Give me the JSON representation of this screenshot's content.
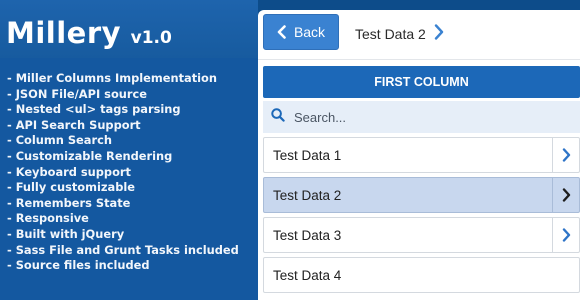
{
  "brand": {
    "name": "Millery",
    "version": "v1.0"
  },
  "features": [
    "- Miller Columns Implementation",
    "- JSON File/API source",
    "- Nested <ul> tags parsing",
    "- API Search Support",
    "- Column Search",
    "- Customizable Rendering",
    "- Keyboard support",
    "- Fully customizable",
    "- Remembers State",
    "- Responsive",
    "- Built with jQuery",
    "- Sass File and Grunt Tasks included",
    "- Source files included"
  ],
  "toolbar": {
    "back_label": "Back",
    "breadcrumb": "Test Data 2"
  },
  "column": {
    "title": "FIRST COLUMN",
    "search_placeholder": "Search...",
    "items": [
      {
        "label": "Test Data 1",
        "has_children": true,
        "active": false
      },
      {
        "label": "Test Data 2",
        "has_children": true,
        "active": true
      },
      {
        "label": "Test Data 3",
        "has_children": true,
        "active": false
      },
      {
        "label": "Test Data 4",
        "has_children": false,
        "active": false
      }
    ]
  },
  "colors": {
    "accent": "#1c68b8",
    "button": "#3a82d1",
    "active_row": "#c8d7ee",
    "left_panel": "#1458a0"
  },
  "icons": {
    "back": "chevron-left-icon",
    "breadcrumb": "chevron-right-icon",
    "search": "search-icon",
    "row": "chevron-right-icon"
  }
}
